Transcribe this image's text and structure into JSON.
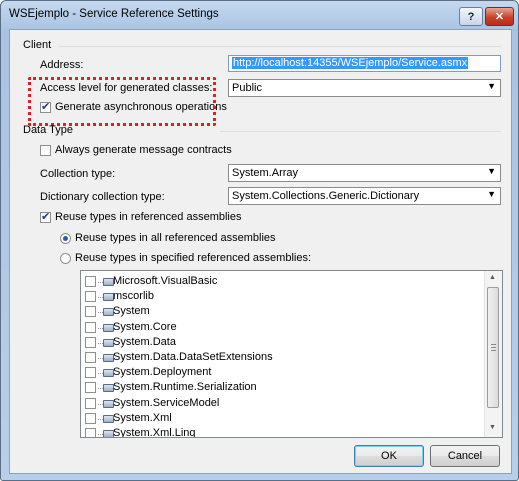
{
  "window": {
    "title": "WSEjemplo - Service Reference Settings",
    "help_label": "?",
    "close_label": "✕"
  },
  "client": {
    "section_label": "Client",
    "address_label": "Address:",
    "address_value": "http://localhost:14355/WSEjemplo/Service.asmx",
    "access_label": "Access level for generated classes:",
    "access_value": "Public",
    "async_label": "Generate asynchronous operations",
    "async_checked": true
  },
  "data_type": {
    "section_label": "Data Type",
    "always_generate_label": "Always generate message contracts",
    "always_generate_checked": false,
    "collection_label": "Collection type:",
    "collection_value": "System.Array",
    "dictionary_label": "Dictionary collection type:",
    "dictionary_value": "System.Collections.Generic.Dictionary",
    "reuse_label": "Reuse types in referenced assemblies",
    "reuse_checked": true,
    "reuse_all_label": "Reuse types in all referenced assemblies",
    "reuse_specified_label": "Reuse types in specified referenced assemblies:",
    "assemblies": [
      "Microsoft.VisualBasic",
      "mscorlib",
      "System",
      "System.Core",
      "System.Data",
      "System.Data.DataSetExtensions",
      "System.Deployment",
      "System.Runtime.Serialization",
      "System.ServiceModel",
      "System.Xml",
      "System.Xml.Linq"
    ]
  },
  "buttons": {
    "ok": "OK",
    "cancel": "Cancel"
  },
  "colors": {
    "accent": "#3399ff",
    "annotation": "#e02020"
  }
}
